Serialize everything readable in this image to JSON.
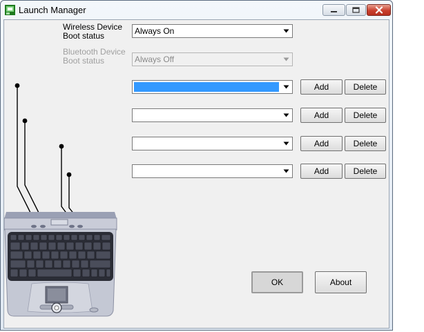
{
  "window": {
    "title": "Launch Manager"
  },
  "wireless": {
    "label_line1": "Wireless Device",
    "label_line2": "Boot status",
    "value": "Always On"
  },
  "bluetooth": {
    "label_line1": "Bluetooth Device",
    "label_line2": "Boot status",
    "value": "Always Off"
  },
  "key_rows": [
    {
      "value": "",
      "selected": true,
      "add_label": "Add",
      "delete_label": "Delete"
    },
    {
      "value": "",
      "selected": false,
      "add_label": "Add",
      "delete_label": "Delete"
    },
    {
      "value": "",
      "selected": false,
      "add_label": "Add",
      "delete_label": "Delete"
    },
    {
      "value": "",
      "selected": false,
      "add_label": "Add",
      "delete_label": "Delete"
    }
  ],
  "footer": {
    "ok_label": "OK",
    "about_label": "About"
  },
  "icons": {
    "app": "launch-manager-icon",
    "minimize": "minimize-icon",
    "maximize": "maximize-icon",
    "close": "close-icon",
    "dropdown": "dropdown-arrow-icon"
  },
  "colors": {
    "selection": "#3399ff",
    "close_button": "#c9402e"
  }
}
